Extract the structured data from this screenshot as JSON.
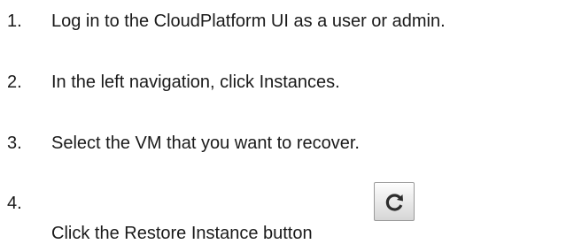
{
  "steps": [
    {
      "number": "1.",
      "text": "Log in to the CloudPlatform UI as a user or admin."
    },
    {
      "number": "2.",
      "text": "In the left navigation, click Instances."
    },
    {
      "number": "3.",
      "text": "Select the VM that you want to recover."
    },
    {
      "number": "4.",
      "text": "Click the Restore Instance button"
    }
  ],
  "restore_button": {
    "icon": "restore-icon"
  }
}
